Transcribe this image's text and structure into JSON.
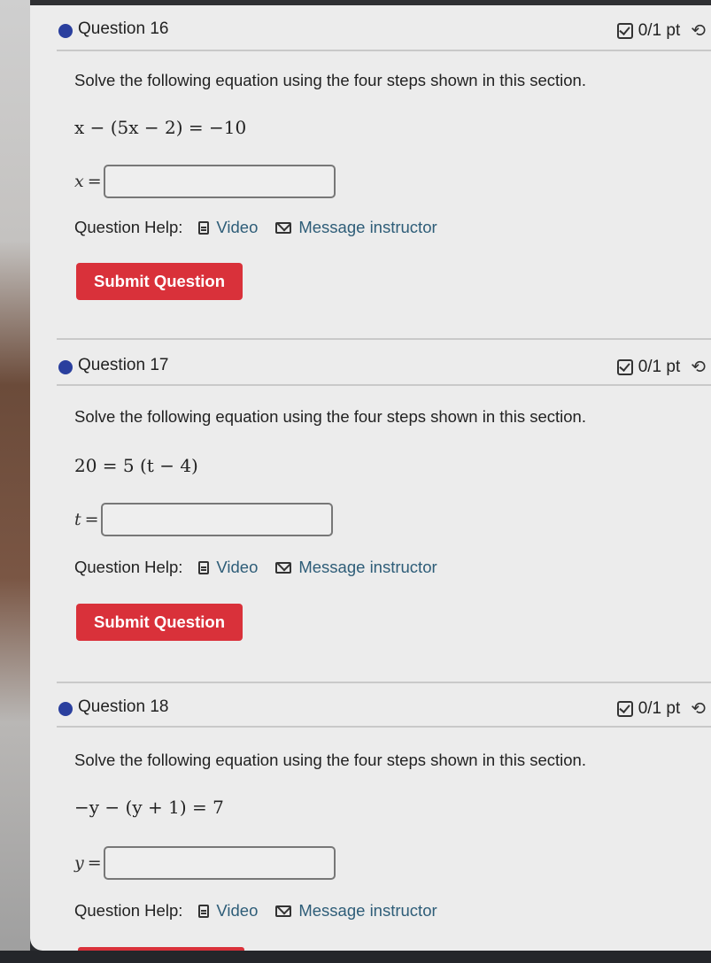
{
  "questions": [
    {
      "title": "Question 16",
      "score": "0/1 pt",
      "prompt": "Solve the following equation using the four steps shown in this section.",
      "equation": "x − (5x − 2) = −10",
      "answer_variable": "x",
      "answer_equals": "=",
      "answer_value": "",
      "help_label": "Question Help:",
      "video_label": "Video",
      "message_label": "Message instructor",
      "submit_label": "Submit Question"
    },
    {
      "title": "Question 17",
      "score": "0/1 pt",
      "prompt": "Solve the following equation using the four steps shown in this section.",
      "equation": "20 = 5 (t − 4)",
      "answer_variable": "t",
      "answer_equals": "=",
      "answer_value": "",
      "help_label": "Question Help:",
      "video_label": "Video",
      "message_label": "Message instructor",
      "submit_label": "Submit Question"
    },
    {
      "title": "Question 18",
      "score": "0/1 pt",
      "prompt": "Solve the following equation using the four steps shown in this section.",
      "equation": "−y − (y + 1) = 7",
      "answer_variable": "y",
      "answer_equals": "=",
      "answer_value": "",
      "help_label": "Question Help:",
      "video_label": "Video",
      "message_label": "Message instructor"
    }
  ],
  "icons": {
    "status_dot": "filled-circle",
    "score": "checkbox-icon",
    "retry": "retry-icon",
    "video": "document-icon",
    "message": "envelope-icon"
  },
  "colors": {
    "accent_blue": "#2a3f9e",
    "submit_red": "#d9313a",
    "link_teal": "#2e5d78"
  }
}
